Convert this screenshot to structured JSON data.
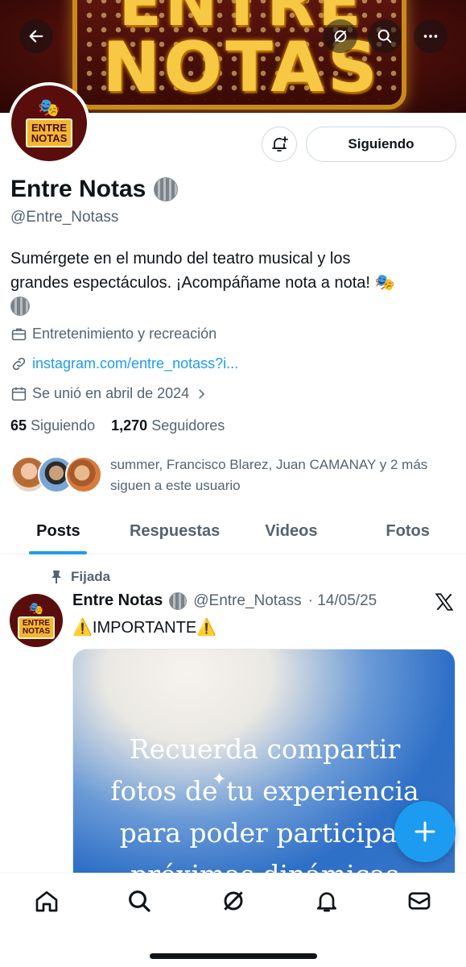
{
  "banner": {
    "line1": "ENTRE",
    "line2": "NOTAS"
  },
  "avatar_logo": {
    "line1": "ENTRE",
    "line2": "NOTAS"
  },
  "profile": {
    "name": "Entre Notas",
    "handle": "@Entre_Notass",
    "bio_line1": "Sumérgete en el mundo del teatro musical y los",
    "bio_line2": "grandes espectáculos. ¡Acompáñame nota a nota!",
    "category": "Entretenimiento y recreación",
    "link": "instagram.com/entre_notass?i...",
    "joined": "Se unió en abril de 2024",
    "following_count": "65",
    "following_label": "Siguiendo",
    "followers_count": "1,270",
    "followers_label": "Seguidores",
    "followed_by": "summer, Francisco Blarez, Juan CAMANAY y 2 más siguen a este usuario"
  },
  "actions": {
    "following_button": "Siguiendo"
  },
  "tabs": [
    {
      "label": "Posts",
      "active": true
    },
    {
      "label": "Respuestas",
      "active": false
    },
    {
      "label": "Videos",
      "active": false
    },
    {
      "label": "Fotos",
      "active": false
    }
  ],
  "post": {
    "pinned_label": "Fijada",
    "author": "Entre Notas",
    "handle": "@Entre_Notass",
    "date": "· 14/05/25",
    "text": "⚠️IMPORTANTE⚠️",
    "image_lines": [
      "Recuerda compartir",
      "fotos de tu experiencia",
      "para poder participar",
      "próximas dinámicas"
    ]
  },
  "colors": {
    "accent": "#1d9bf0",
    "secondary_text": "#536471",
    "brand_maroon": "#5a0d0d",
    "brand_gold": "#f2b632"
  }
}
